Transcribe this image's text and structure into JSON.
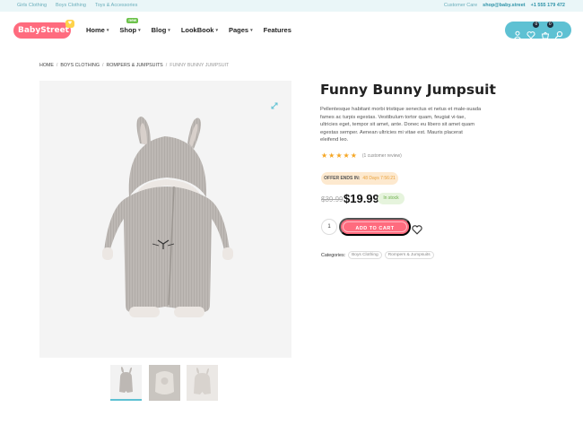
{
  "topbar": {
    "links": [
      "Girls Clothing",
      "Boys Clothing",
      "Toys & Accessories"
    ],
    "care_label": "Customer Care",
    "email": "shop@baby.street",
    "phone": "+1 555 179 472"
  },
  "header": {
    "logo_text": "BabyStreet",
    "nav": [
      {
        "label": "Home",
        "has_dropdown": true
      },
      {
        "label": "Shop",
        "has_dropdown": true,
        "badge": "new"
      },
      {
        "label": "Blog",
        "has_dropdown": true
      },
      {
        "label": "LookBook",
        "has_dropdown": true
      },
      {
        "label": "Pages",
        "has_dropdown": true
      },
      {
        "label": "Features",
        "has_dropdown": false
      }
    ],
    "icons": {
      "account": "user-icon",
      "wishlist": "heart-icon",
      "wishlist_count": "0",
      "cart": "cart-icon",
      "cart_count": "0",
      "search": "search-icon"
    },
    "accent_color": "#5ec1d3",
    "brand_color": "#ff6b7e"
  },
  "breadcrumb": [
    "Home",
    "Boys Clothing",
    "Rompers & Jumpsuits",
    "Funny Bunny Jumpsuit"
  ],
  "product": {
    "title": "Funny Bunny Jumpsuit",
    "description": "Pellentesque habitant morbi tristique senectus et netus et male-suada fames ac turpis egestas. Vestibulum tortor quam, feugiat vi-tae, ultricies eget, tempor sit amet, ante. Donec eu libero sit amet quam egestas semper. Aenean ultricies mi vitae est. Mauris placerat eleifend leo.",
    "rating": 5,
    "rating_text": "(1 customer review)",
    "offer_label": "Offer ends in:",
    "offer_time": "48 Days 7:56:21",
    "old_price": "$39.99",
    "price": "$19.99",
    "stock": "In stock",
    "quantity": "1",
    "add_to_cart": "Add to cart",
    "categories_label": "Categories:",
    "categories": [
      "Boys Clothing",
      "Rompers & Jumpsuits"
    ]
  }
}
